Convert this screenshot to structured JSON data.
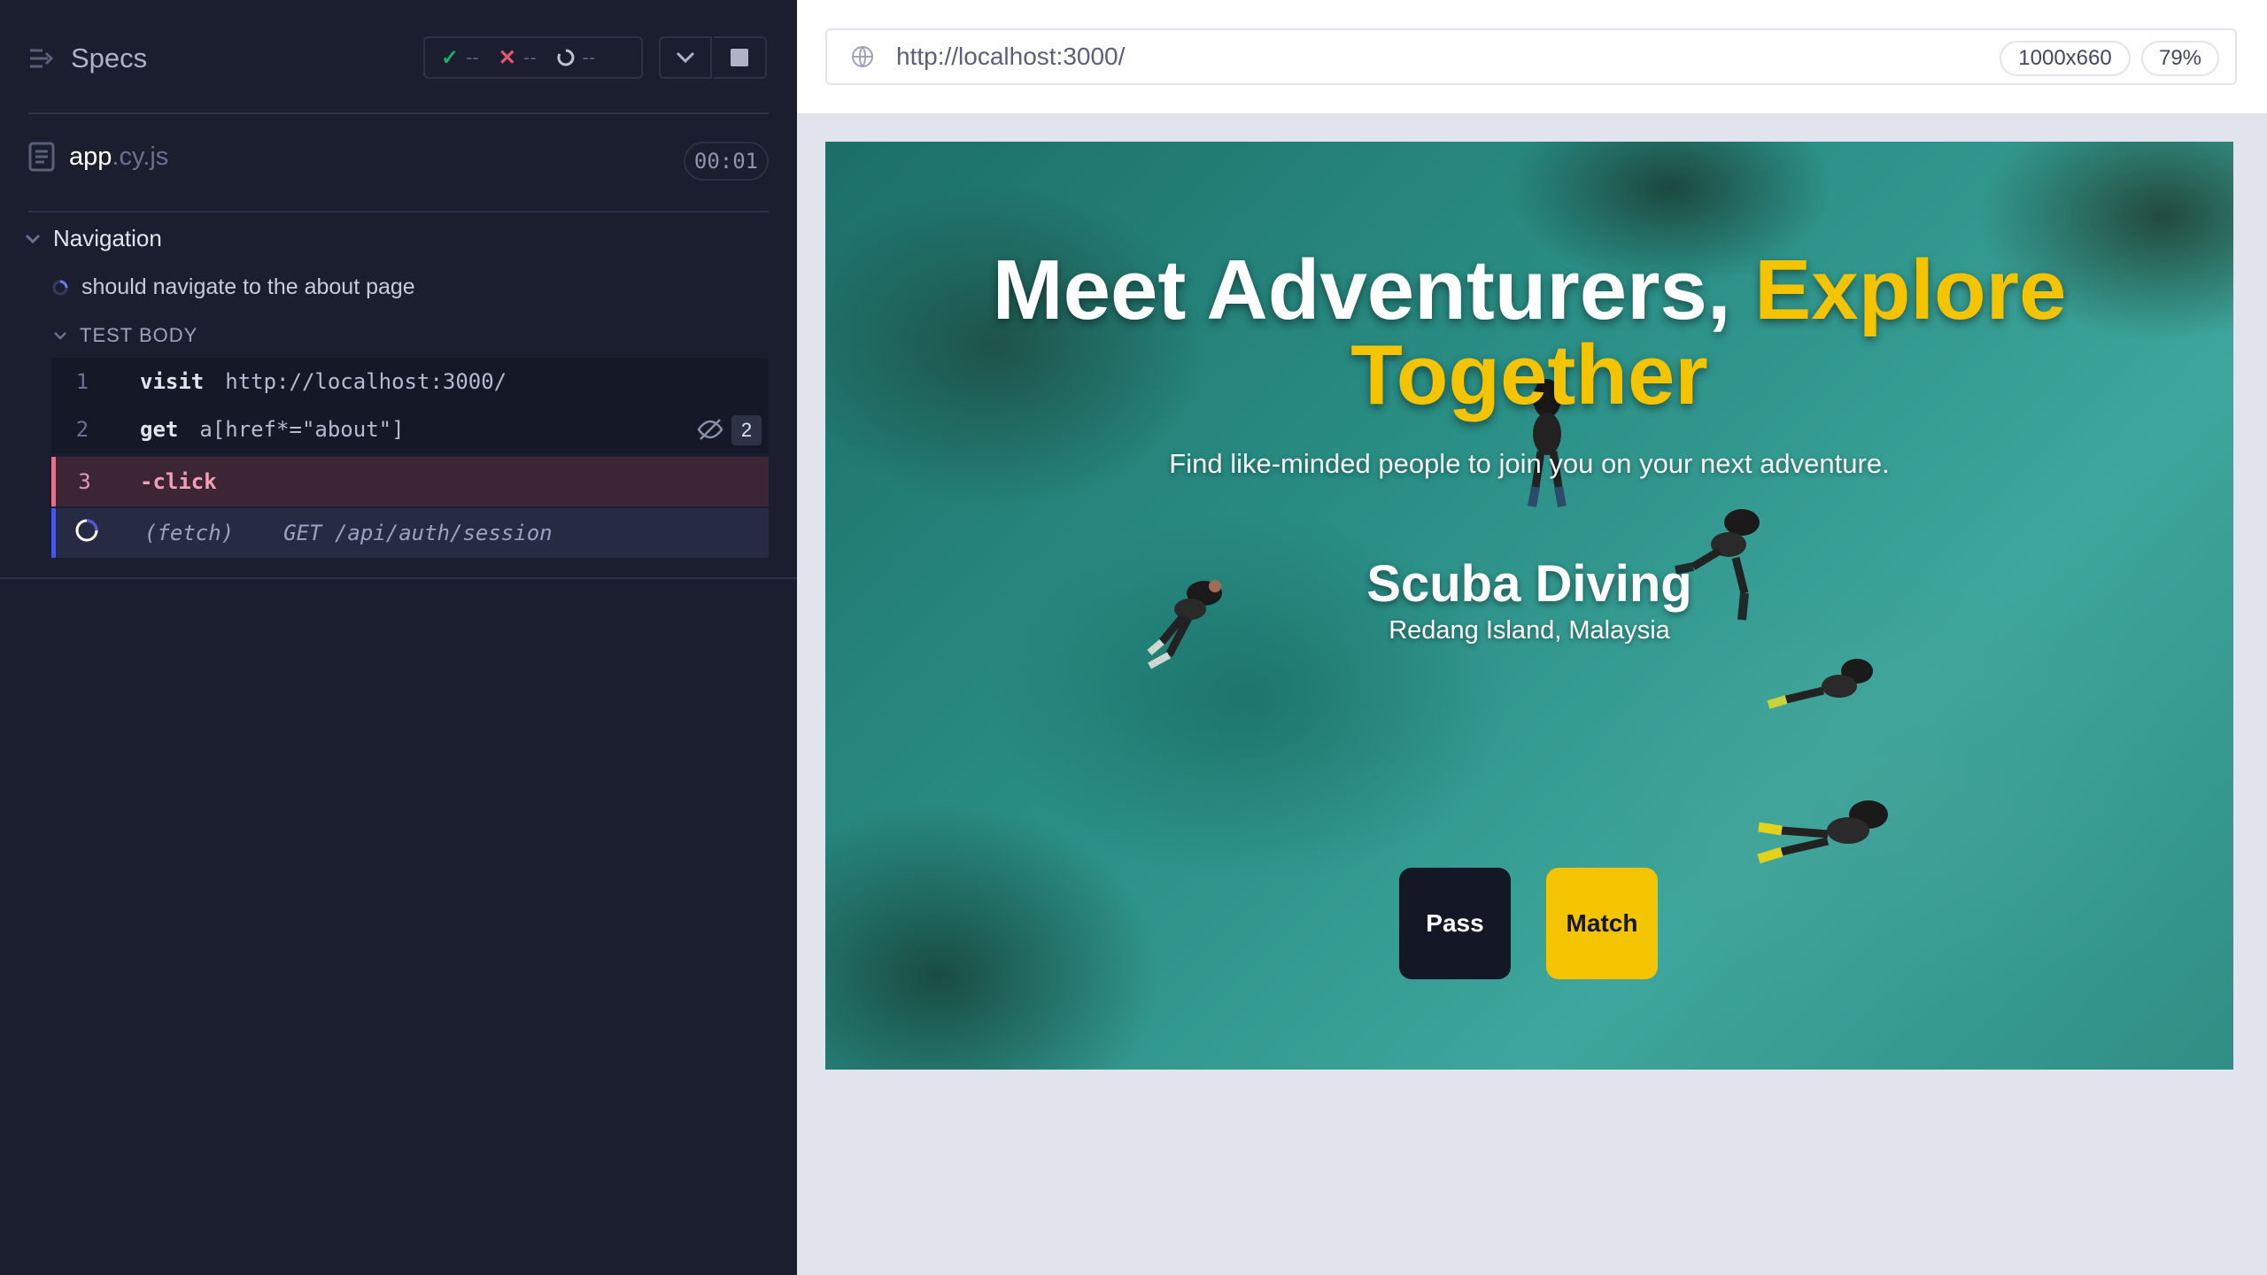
{
  "reporter": {
    "title": "Specs",
    "stats": {
      "passed": "--",
      "failed": "--",
      "pending": "--"
    },
    "file": {
      "name": "app",
      "ext": ".cy.js",
      "duration": "00:01"
    },
    "suite": "Navigation",
    "test": "should navigate to the about page",
    "section": "TEST BODY",
    "commands": [
      {
        "num": "1",
        "name": "visit",
        "arg": "http://localhost:3000/"
      },
      {
        "num": "2",
        "name": "get",
        "arg": "a[href*=\"about\"]",
        "count": "2"
      },
      {
        "num": "3",
        "name": "-click",
        "arg": ""
      },
      {
        "num": "",
        "name": "(fetch)",
        "arg": "GET /api/auth/session"
      }
    ]
  },
  "aut": {
    "url": "http://localhost:3000/",
    "viewport": "1000x660",
    "zoom": "79%",
    "page": {
      "headline_white": "Meet Adventurers, ",
      "headline_accent": "Explore Together",
      "subline": "Find like-minded people to join you on your next adventure.",
      "activity": "Scuba Diving",
      "location": "Redang Island, Malaysia",
      "pass_label": "Pass",
      "match_label": "Match"
    }
  },
  "colors": {
    "accent": "#f5c400",
    "fail": "#e45770",
    "pass": "#1fa971",
    "running": "#4956e3"
  }
}
